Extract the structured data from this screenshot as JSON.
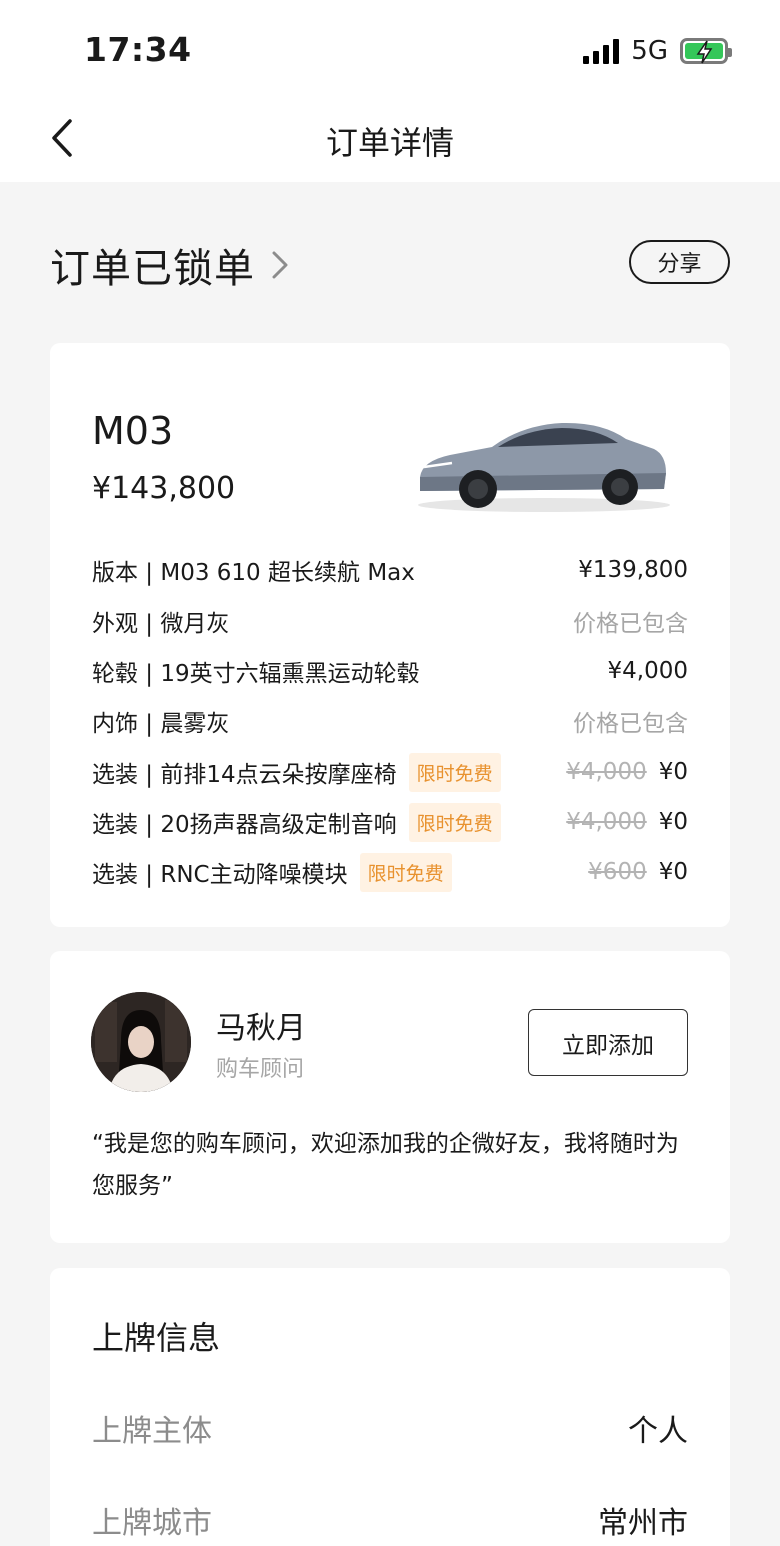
{
  "status_bar": {
    "time": "17:34",
    "network": "5G"
  },
  "nav": {
    "title": "订单详情"
  },
  "order_status": {
    "title": "订单已锁单",
    "share_label": "分享"
  },
  "car": {
    "model": "M03",
    "total_price": "¥143,800",
    "configs": [
      {
        "label": "版本 | M03 610 超长续航 Max",
        "price": "¥139,800"
      },
      {
        "label": "外观 | 微月灰",
        "price": "价格已包含"
      },
      {
        "label": "轮毂 | 19英寸六辐熏黑运动轮毂",
        "price": "¥4,000"
      },
      {
        "label": "内饰 | 晨雾灰",
        "price": "价格已包含"
      },
      {
        "label": "选装 | 前排14点云朵按摩座椅",
        "tag": "限时免费",
        "original_price": "¥4,000",
        "price": "¥0"
      },
      {
        "label": "选装 | 20扬声器高级定制音响",
        "tag": "限时免费",
        "original_price": "¥4,000",
        "price": "¥0"
      },
      {
        "label": "选装 | RNC主动降噪模块",
        "tag": "限时免费",
        "original_price": "¥600",
        "price": "¥0"
      }
    ]
  },
  "advisor": {
    "name": "马秋月",
    "role": "购车顾问",
    "add_label": "立即添加",
    "message": "“我是您的购车顾问，欢迎添加我的企微好友，我将随时为您服务”"
  },
  "plate_info": {
    "title": "上牌信息",
    "rows": [
      {
        "label": "上牌主体",
        "value": "个人"
      },
      {
        "label": "上牌城市",
        "value": "常州市"
      }
    ]
  },
  "colors": {
    "tag_bg": "#fff2e3",
    "tag_text": "#e8922f",
    "battery": "#34c759"
  }
}
